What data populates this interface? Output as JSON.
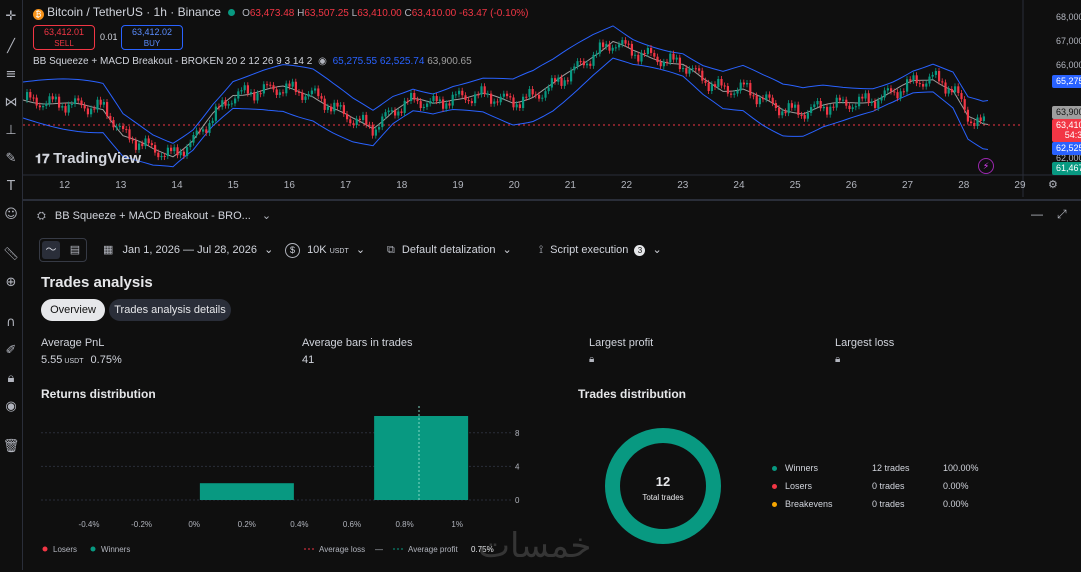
{
  "symbol": {
    "title": "Bitcoin / TetherUS · 1h · Binance",
    "open_label": "O",
    "open": "63,473.48",
    "high_label": "H",
    "high": "63,507.25",
    "low_label": "L",
    "low": "63,410.00",
    "close_label": "C",
    "close": "63,410.00",
    "change": "-63.47 (-0.10%)"
  },
  "trade": {
    "sell_price": "63,412.01",
    "sell_label": "SELL",
    "spread": "0.01",
    "buy_price": "63,412.02",
    "buy_label": "BUY"
  },
  "indicator": {
    "name": "BB Squeeze + MACD Breakout - BROKEN 20 2 12 26 9 3 14 2",
    "v1": "65,275.55",
    "v2": "62,525.74",
    "v3": "63,900.65"
  },
  "watermark": "TradingView",
  "price_axis": [
    "68,000.00",
    "67,000.00",
    "66,000.00",
    "62,000.00"
  ],
  "price_tags": {
    "upper": "65,275.55",
    "basis": "63,900.65",
    "last": "63,410.00",
    "countdown": "54:37",
    "lower": "62,525.74",
    "low": "61,467.49"
  },
  "time_axis": [
    "12",
    "13",
    "14",
    "15",
    "16",
    "17",
    "18",
    "19",
    "20",
    "21",
    "22",
    "23",
    "24",
    "25",
    "26",
    "27",
    "28",
    "29"
  ],
  "panel": {
    "tab_title": "BB Squeeze + MACD Breakout - BRO...",
    "date_range": "Jan 1, 2026 — Jul 28, 2026",
    "capital": "10K",
    "capital_unit": "USDT",
    "detalization": "Default detalization",
    "script_execution": "Script execution",
    "script_badge": "3",
    "section_title": "Trades analysis",
    "tabs": [
      "Overview",
      "Trades analysis details"
    ],
    "metrics": [
      {
        "label": "Average PnL",
        "value": "5.55",
        "unit": "USDT",
        "extra": "0.75%"
      },
      {
        "label": "Average bars in trades",
        "value": "41"
      },
      {
        "label": "Largest profit"
      },
      {
        "label": "Largest loss"
      }
    ],
    "returns_title": "Returns distribution",
    "trades_title": "Trades distribution"
  },
  "chart_data": [
    {
      "type": "bar",
      "title": "Returns distribution",
      "categories": [
        "-0.4%",
        "-0.2%",
        "0%",
        "0.2%",
        "0.4%",
        "0.6%",
        "0.8%",
        "1%"
      ],
      "series": [
        {
          "name": "Winners",
          "values": [
            0,
            0,
            0,
            2,
            0,
            0,
            10,
            0
          ]
        }
      ],
      "yticks": [
        "8",
        "4",
        "0"
      ],
      "ylim": [
        0,
        10
      ],
      "colors": {
        "winners": "#089981",
        "losers": "#f23645"
      },
      "legend": [
        "Losers",
        "Winners"
      ],
      "lines": [
        {
          "name": "Average loss",
          "value": "—"
        },
        {
          "name": "Average profit",
          "value": "0.75%"
        }
      ]
    },
    {
      "type": "pie",
      "title": "Trades distribution",
      "center_value": "12",
      "center_label": "Total trades",
      "rows": [
        {
          "name": "Winners",
          "count": "12 trades",
          "pct": "100.00%",
          "value": 12,
          "color": "#089981"
        },
        {
          "name": "Losers",
          "count": "0 trades",
          "pct": "0.00%",
          "value": 0,
          "color": "#f23645"
        },
        {
          "name": "Breakevens",
          "count": "0 trades",
          "pct": "0.00%",
          "value": 0,
          "color": "#f7a600"
        }
      ]
    }
  ],
  "annotation": "before",
  "site_watermark": "خمسات",
  "colors": {
    "up": "#089981",
    "down": "#f23645",
    "band": "#2962ff",
    "basis": "#9e9e9e",
    "accent": "#2962ff"
  }
}
